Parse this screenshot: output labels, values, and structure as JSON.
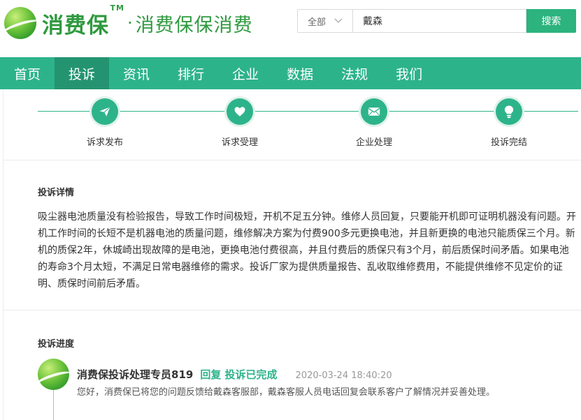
{
  "header": {
    "logo_text": "消费保",
    "logo_tm": "TM",
    "logo_dot": "·",
    "slogan": "消费保保消费"
  },
  "search": {
    "scope": "全部",
    "query": "戴森",
    "button_label": "搜索"
  },
  "nav": {
    "items": [
      "首页",
      "投诉",
      "资讯",
      "排行",
      "企业",
      "数据",
      "法规",
      "我们"
    ],
    "active": "投诉"
  },
  "steps": [
    {
      "label": "诉求发布",
      "icon": "paper-plane-icon"
    },
    {
      "label": "诉求受理",
      "icon": "heart-icon"
    },
    {
      "label": "企业处理",
      "icon": "mail-icon"
    },
    {
      "label": "投诉完结",
      "icon": "lightbulb-icon"
    }
  ],
  "details": {
    "title": "投诉详情",
    "text": "吸尘器电池质量没有检验报告，导致工作时间极短，开机不足五分钟。维修人员回复，只要能开机即可证明机器没有问题。开机工作时间的长短不是机器电池的质量问题，维修解决方案为付费900多元更换电池，并且新更换的电池只能质保三个月。新机的质保2年，休城崎出现故障的是电池，更换电池付费很高，并且付费后的质保只有3个月，前后质保时间矛盾。如果电池的寿命3个月太短，不满足日常电器维修的需求。投诉厂家为提供质量报告、乱收取维修费用，不能提供维修不见定价的证明、质保时间前后矛盾。"
  },
  "progress": {
    "title": "投诉进度",
    "entries": [
      {
        "name": "消费保投诉处理专员819",
        "status": "回复 投诉已完成",
        "time": "2020-03-24 18:40:20",
        "text": "您好，消费保已将您的问题反馈给戴森客服部，戴森客服人员电话回复会联系客户了解情况并妥善处理。"
      }
    ]
  },
  "colors": {
    "brand_green": "#2db38a",
    "nav_active": "#249470",
    "logo_green": "#2f9a3f",
    "search_button": "#2cb37e"
  }
}
